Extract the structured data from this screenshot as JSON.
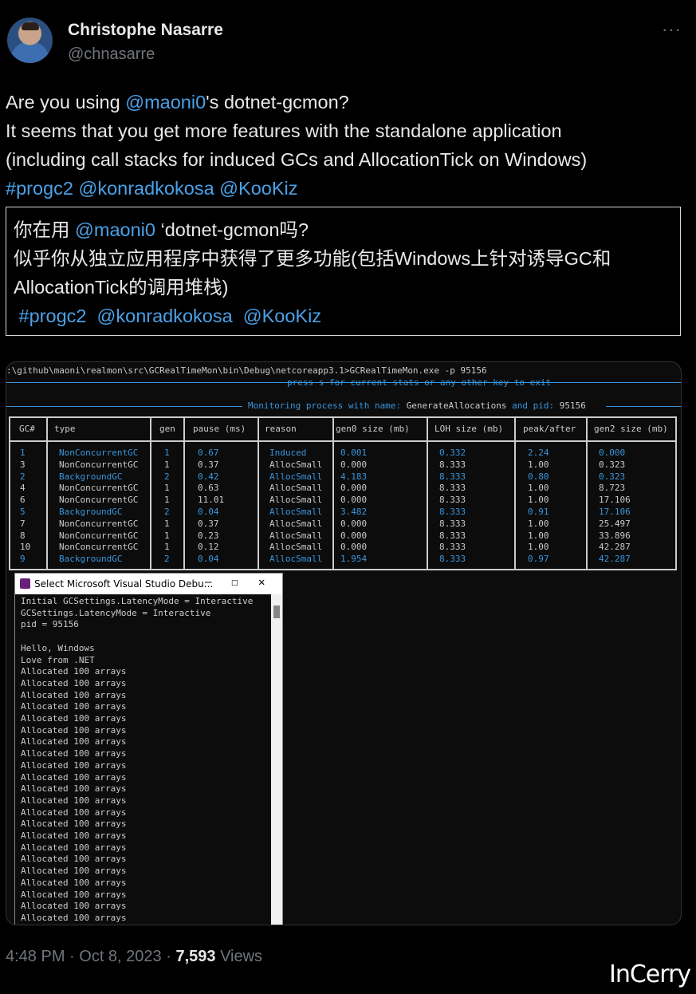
{
  "author": {
    "name": "Christophe Nasarre",
    "handle": "@chnasarre"
  },
  "more_label": "···",
  "tweet": {
    "l1_pre": "Are you using ",
    "l1_link": "@maoni0",
    "l1_post": "'s dotnet-gcmon?",
    "l2": "It seems that you get more features with the standalone application",
    "l3": "(including call stacks for induced GCs and AllocationTick on Windows)",
    "tags": [
      "#progc2",
      "@konradkokosa",
      "@KooKiz"
    ]
  },
  "translation": {
    "l1_pre": "你在用 ",
    "l1_link": "@maoni0",
    "l1_post": " ‘dotnet-gcmon吗?",
    "l2": "似乎你从独立应用程序中获得了更多功能(包括Windows上针对诱导GC和",
    "l3": "AllocationTick的调用堆栈)",
    "tags": [
      "#progc2",
      "@konradkokosa",
      "@KooKiz"
    ]
  },
  "terminal": {
    "cmd": ":\\github\\maoni\\realmon\\src\\GCRealTimeMon\\bin\\Debug\\netcoreapp3.1>GCRealTimeMon.exe -p 95156",
    "hint": "press s for current stats or any other key to exit",
    "monitor_pre": "Monitoring process with name: ",
    "monitor_name": "GenerateAllocations",
    "monitor_mid": " and pid: ",
    "monitor_pid": "95156",
    "headers": [
      "GC#",
      "type",
      "gen",
      "pause (ms)",
      "reason",
      "gen0 size (mb)",
      "LOH size (mb)",
      "peak/after",
      "gen2 size (mb)"
    ],
    "rows": [
      [
        "1",
        "NonConcurrentGC",
        "1",
        "0.67",
        "Induced",
        "0.001",
        "0.332",
        "2.24",
        "0.000"
      ],
      [
        "3",
        "NonConcurrentGC",
        "1",
        "0.37",
        "AllocSmall",
        "0.000",
        "8.333",
        "1.00",
        "0.323"
      ],
      [
        "2",
        "BackgroundGC",
        "2",
        "0.42",
        "AllocSmall",
        "4.183",
        "8.333",
        "0.80",
        "0.323"
      ],
      [
        "4",
        "NonConcurrentGC",
        "1",
        "0.63",
        "AllocSmall",
        "0.000",
        "8.333",
        "1.00",
        "8.723"
      ],
      [
        "6",
        "NonConcurrentGC",
        "1",
        "11.01",
        "AllocSmall",
        "0.000",
        "8.333",
        "1.00",
        "17.106"
      ],
      [
        "5",
        "BackgroundGC",
        "2",
        "0.04",
        "AllocSmall",
        "3.482",
        "8.333",
        "0.91",
        "17.106"
      ],
      [
        "7",
        "NonConcurrentGC",
        "1",
        "0.37",
        "AllocSmall",
        "0.000",
        "8.333",
        "1.00",
        "25.497"
      ],
      [
        "8",
        "NonConcurrentGC",
        "1",
        "0.23",
        "AllocSmall",
        "0.000",
        "8.333",
        "1.00",
        "33.896"
      ],
      [
        "10",
        "NonConcurrentGC",
        "1",
        "0.12",
        "AllocSmall",
        "0.000",
        "8.333",
        "1.00",
        "42.287"
      ],
      [
        "9",
        "BackgroundGC",
        "2",
        "0.04",
        "AllocSmall",
        "1.954",
        "8.333",
        "0.97",
        "42.287"
      ]
    ]
  },
  "debug_window": {
    "title": "Select Microsoft Visual Studio Debu...",
    "controls": [
      "—",
      "☐",
      "✕"
    ],
    "lines": [
      "Initial GCSettings.LatencyMode = Interactive",
      "GCSettings.LatencyMode = Interactive",
      "pid = 95156",
      "",
      "Hello, Windows",
      "Love from .NET",
      "Allocated 100 arrays",
      "Allocated 100 arrays",
      "Allocated 100 arrays",
      "Allocated 100 arrays",
      "Allocated 100 arrays",
      "Allocated 100 arrays",
      "Allocated 100 arrays",
      "Allocated 100 arrays",
      "Allocated 100 arrays",
      "Allocated 100 arrays",
      "Allocated 100 arrays",
      "Allocated 100 arrays",
      "Allocated 100 arrays",
      "Allocated 100 arrays",
      "Allocated 100 arrays",
      "Allocated 100 arrays",
      "Allocated 100 arrays",
      "Allocated 100 arrays",
      "Allocated 100 arrays",
      "Allocated 100 arrays",
      "Allocated 100 arrays",
      "Allocated 100 arrays"
    ]
  },
  "footer": {
    "time": "4:48 PM",
    "sep": " · ",
    "date": "Oct 8, 2023",
    "views_count": "7,593",
    "views_label": " Views"
  },
  "watermark": "InCerry",
  "colors": {
    "background": "#000000",
    "text": "#e7e9ea",
    "muted": "#71767b",
    "link": "#4aa1e8",
    "console_blue": "#3a96dd",
    "console_text": "#cccccc"
  }
}
